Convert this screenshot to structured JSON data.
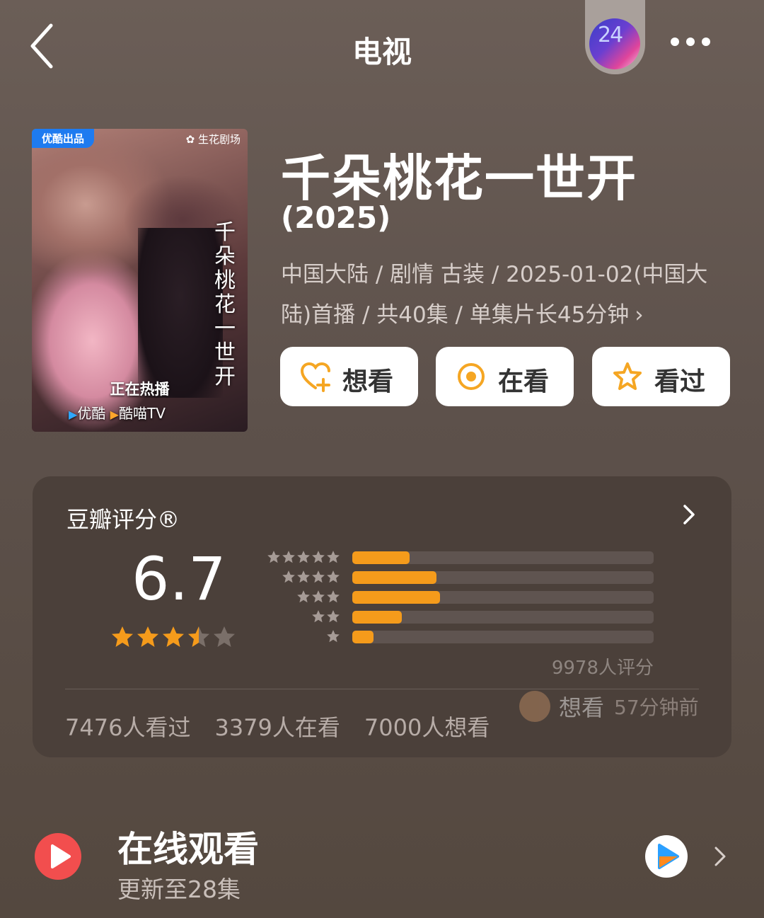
{
  "header": {
    "title": "电视",
    "badge_text": "24"
  },
  "poster": {
    "badge": "优酷出品",
    "studio": "生花剧场",
    "title_vertical": "千朵桃花一世开",
    "airing": "正在热播",
    "platform_1": "优酷",
    "platform_2": "酷喵TV"
  },
  "show": {
    "title": "千朵桃花一世开",
    "year": "(2025)",
    "meta": "中国大陆 / 剧情 古装 / 2025-01-02(中国大陆)首播 / 共40集 / 单集片长45分钟",
    "meta_chevron": "›"
  },
  "actions": {
    "want": "想看",
    "watching": "在看",
    "watched": "看过"
  },
  "rating": {
    "title": "豆瓣评分®",
    "score": "6.7",
    "stars_value": 3.5,
    "distribution": [
      {
        "stars": 5,
        "fraction": 0.19
      },
      {
        "stars": 4,
        "fraction": 0.28
      },
      {
        "stars": 3,
        "fraction": 0.29
      },
      {
        "stars": 2,
        "fraction": 0.165
      },
      {
        "stars": 1,
        "fraction": 0.07
      }
    ],
    "count_text": "9978人评分",
    "watched_text": "7476人看过",
    "watching_text": "3379人在看",
    "want_text": "7000人想看",
    "activity_action": "想看",
    "activity_time": "57分钟前"
  },
  "watch": {
    "title": "在线观看",
    "subtitle": "更新至28集"
  },
  "colors": {
    "accent": "#f59b1b",
    "card": "#4b403a",
    "play_red": "#f24e4e"
  }
}
